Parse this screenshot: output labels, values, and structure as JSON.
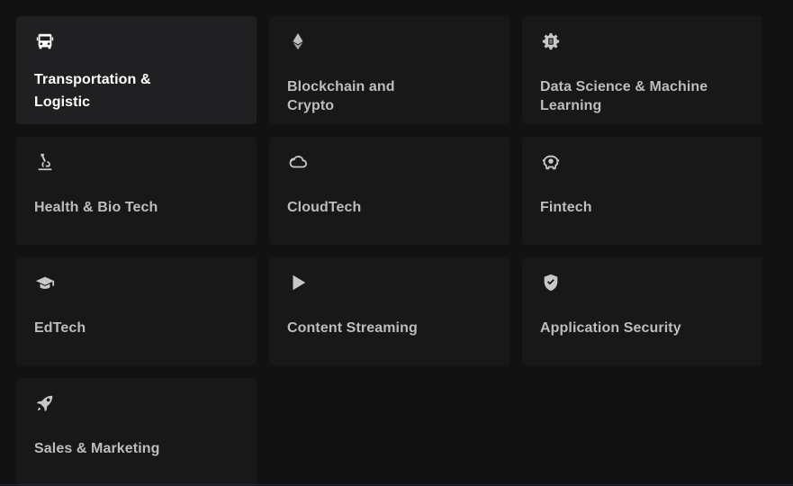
{
  "categories": [
    {
      "label": "Transportation &\nLogistic",
      "icon": "bus-icon",
      "active": true
    },
    {
      "label": "Blockchain and\nCrypto",
      "icon": "ethereum-icon",
      "active": false
    },
    {
      "label": "Data Science & Machine\nLearning",
      "icon": "gear-icon",
      "active": false
    },
    {
      "label": "Health & Bio Tech",
      "icon": "microscope-icon",
      "active": false
    },
    {
      "label": "CloudTech",
      "icon": "cloud-icon",
      "active": false
    },
    {
      "label": "Fintech",
      "icon": "piggy-bank-icon",
      "active": false
    },
    {
      "label": "EdTech",
      "icon": "graduation-cap-icon",
      "active": false
    },
    {
      "label": "Content Streaming",
      "icon": "play-icon",
      "active": false
    },
    {
      "label": "Application Security",
      "icon": "shield-check-icon",
      "active": false
    },
    {
      "label": "Sales & Marketing",
      "icon": "rocket-icon",
      "active": false
    }
  ],
  "colors": {
    "background": "#121212",
    "card": "#181818",
    "card_active": "#202022",
    "text": "#bdbdbd",
    "text_active": "#ffffff"
  }
}
